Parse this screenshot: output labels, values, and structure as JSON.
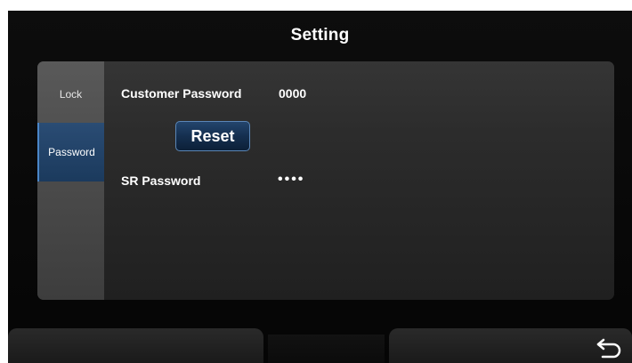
{
  "header": {
    "title": "Setting"
  },
  "sidebar": {
    "tabs": [
      {
        "label": "Lock",
        "active": false
      },
      {
        "label": "Password",
        "active": true
      }
    ]
  },
  "password_page": {
    "customer_password_label": "Customer Password",
    "customer_password_value": "0000",
    "reset_label": "Reset",
    "sr_password_label": "SR Password",
    "sr_password_value": "••••"
  },
  "footer": {
    "back_icon": "back-arrow-icon"
  },
  "colors": {
    "accent": "#1b3a5d",
    "accent_border": "#4a86c8",
    "background": "#0a0a0a"
  }
}
